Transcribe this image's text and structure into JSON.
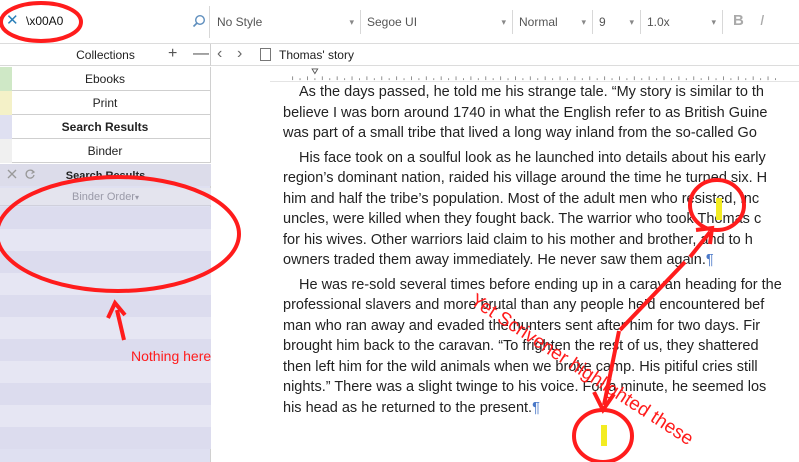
{
  "toolbar": {
    "search_value": "\\x00A0",
    "style_value": "No Style",
    "font_value": "Segoe UI",
    "weight_value": "Normal",
    "size_value": "9",
    "spacing_value": "1.0x",
    "bold_label": "B",
    "italic_label": "I"
  },
  "collections": {
    "title": "Collections",
    "tabs": [
      "Ebooks",
      "Print",
      "Search Results",
      "Binder"
    ],
    "active_result": {
      "title": "Search Results",
      "sort_label": "Binder Order"
    }
  },
  "editor": {
    "document_title": "Thomas' story",
    "lines": [
      "As the days passed, he told me his strange tale. “My story is similar to th",
      "believe I was born around 1740 in what the English refer to as British Guine",
      "was part of a small tribe that lived a long way inland from the so-called Go",
      "His face took on a soulful look as he launched into details about his early",
      "region’s dominant nation, raided his village around the time he turned six. H",
      "him and half the tribe’s population. Most of the adult men who resisted, inc",
      "uncles, were killed when they fought back. The warrior who took Thomas c",
      "for his wives. Other warriors laid claim to his mother and brother, and to h",
      "owners traded them away immediately. He never saw them again.",
      "He was re-sold several times before ending up in a caravan heading for the",
      "professional slavers and more brutal than any people he’d encountered bef",
      "man who ran away and evaded the hunters sent after him for two days. Fir",
      "brought him back to the caravan. “To frighten the rest of us, they shattered",
      "then left him for the wild animals when we broke camp. His pitiful cries still",
      "nights.” There was a slight twinge to his voice. For a minute, he seemed los",
      "his head as he returned to the present."
    ],
    "pilcrow": "¶"
  },
  "annotations": {
    "nothing_here": "Nothing here",
    "highlighted": "Yet Scrivener highlighted these",
    "color": "#ff1c1c",
    "highlight_color": "#f3ec22"
  }
}
